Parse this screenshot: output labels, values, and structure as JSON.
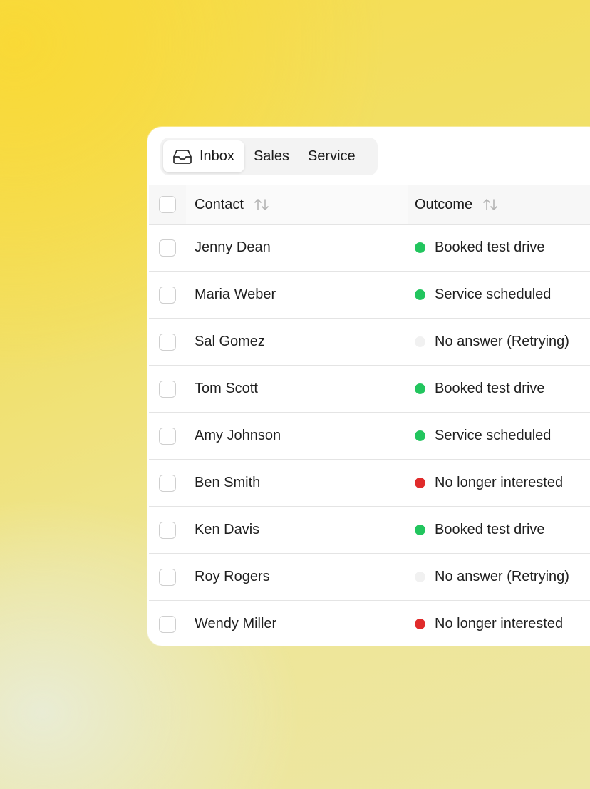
{
  "tabs": [
    {
      "label": "Inbox",
      "active": true,
      "icon": "inbox-icon"
    },
    {
      "label": "Sales",
      "active": false
    },
    {
      "label": "Service",
      "active": false
    }
  ],
  "table": {
    "columns": {
      "contact": "Contact",
      "outcome": "Outcome"
    },
    "rows": [
      {
        "contact": "Jenny Dean",
        "outcome": "Booked test drive",
        "status": "success"
      },
      {
        "contact": "Maria Weber",
        "outcome": "Service scheduled",
        "status": "success"
      },
      {
        "contact": "Sal Gomez",
        "outcome": "No answer (Retrying)",
        "status": "neutral"
      },
      {
        "contact": "Tom Scott",
        "outcome": "Booked test drive",
        "status": "success"
      },
      {
        "contact": "Amy Johnson",
        "outcome": "Service scheduled",
        "status": "success"
      },
      {
        "contact": "Ben Smith",
        "outcome": "No longer interested",
        "status": "danger"
      },
      {
        "contact": "Ken Davis",
        "outcome": "Booked test drive",
        "status": "success"
      },
      {
        "contact": "Roy Rogers",
        "outcome": "No answer (Retrying)",
        "status": "neutral"
      },
      {
        "contact": "Wendy Miller",
        "outcome": "No longer interested",
        "status": "danger"
      }
    ]
  },
  "colors": {
    "success": "#22c55e",
    "danger": "#e02b2b",
    "neutral": "#f1f1f1"
  }
}
